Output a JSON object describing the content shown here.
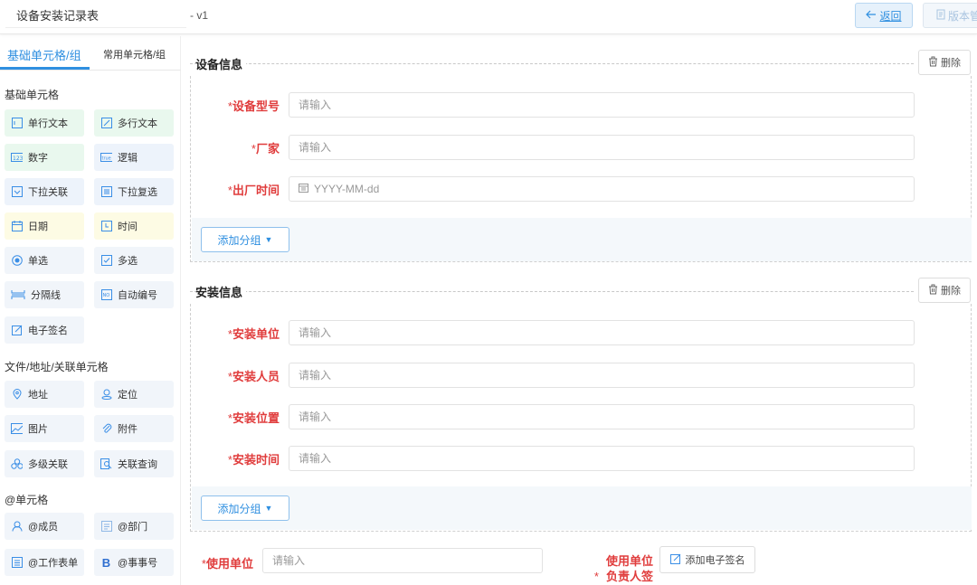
{
  "header": {
    "form_title": "设备安装记录表",
    "version": "- v1",
    "back_label": "返回",
    "version_manage_label": "版本管"
  },
  "left_panel": {
    "tabs": [
      {
        "label": "基础单元格/组",
        "active": true
      },
      {
        "label": "常用单元格/组",
        "active": false
      }
    ],
    "sections": [
      {
        "title": "基础单元格",
        "items": [
          {
            "label": "单行文本",
            "icon": "single-line-text-icon"
          },
          {
            "label": "多行文本",
            "icon": "multi-line-text-icon"
          },
          {
            "label": "数字",
            "icon": "number-icon"
          },
          {
            "label": "逻辑",
            "icon": "boolean-icon"
          },
          {
            "label": "下拉关联",
            "icon": "dropdown-icon"
          },
          {
            "label": "下拉复选",
            "icon": "dropdown-multi-icon"
          },
          {
            "label": "日期",
            "icon": "date-icon"
          },
          {
            "label": "时间",
            "icon": "time-icon"
          },
          {
            "label": "单选",
            "icon": "radio-icon"
          },
          {
            "label": "多选",
            "icon": "checkbox-icon"
          },
          {
            "label": "分隔线",
            "icon": "divider-icon"
          },
          {
            "label": "自动编号",
            "icon": "auto-number-icon"
          },
          {
            "label": "电子签名",
            "icon": "signature-icon"
          }
        ]
      },
      {
        "title": "文件/地址/关联单元格",
        "items": [
          {
            "label": "地址",
            "icon": "address-icon"
          },
          {
            "label": "定位",
            "icon": "location-icon"
          },
          {
            "label": "图片",
            "icon": "image-icon"
          },
          {
            "label": "附件",
            "icon": "attachment-icon"
          },
          {
            "label": "多级关联",
            "icon": "multi-level-icon"
          },
          {
            "label": "关联查询",
            "icon": "lookup-icon"
          }
        ]
      },
      {
        "title": "@单元格",
        "items": [
          {
            "label": "@成员",
            "icon": "member-icon"
          },
          {
            "label": "@部门",
            "icon": "department-icon"
          },
          {
            "label": "@工作表单",
            "icon": "worksheet-icon"
          },
          {
            "label": "@事事号",
            "icon": "account-icon"
          }
        ]
      }
    ]
  },
  "groups": [
    {
      "title": "设备信息",
      "delete_label": "删除",
      "fields": [
        {
          "label": "设备型号",
          "placeholder": "请输入"
        },
        {
          "label": "厂家",
          "placeholder": "请输入"
        },
        {
          "label": "出厂时间",
          "placeholder": "YYYY-MM-dd",
          "type": "date"
        }
      ],
      "add_group_label": "添加分组"
    },
    {
      "title": "安装信息",
      "delete_label": "删除",
      "fields": [
        {
          "label": "安装单位",
          "placeholder": "请输入"
        },
        {
          "label": "安装人员",
          "placeholder": "请输入"
        },
        {
          "label": "安装位置",
          "placeholder": "请输入"
        },
        {
          "label": "安装时间",
          "placeholder": "请输入"
        }
      ],
      "add_group_label": "添加分组"
    }
  ],
  "bottom": {
    "use_unit_label": "使用单位",
    "use_unit_placeholder": "请输入",
    "responsible_label_line1": "使用单位",
    "responsible_label_line2": "负责人签",
    "sign_button_label": "添加电子签名"
  },
  "colors": {
    "accent": "#2f8fe0",
    "required": "#e03c3c",
    "cell_green": "#e9f8ee",
    "cell_yellow": "#fdfbe4",
    "cell_blue": "#edf3fb"
  }
}
